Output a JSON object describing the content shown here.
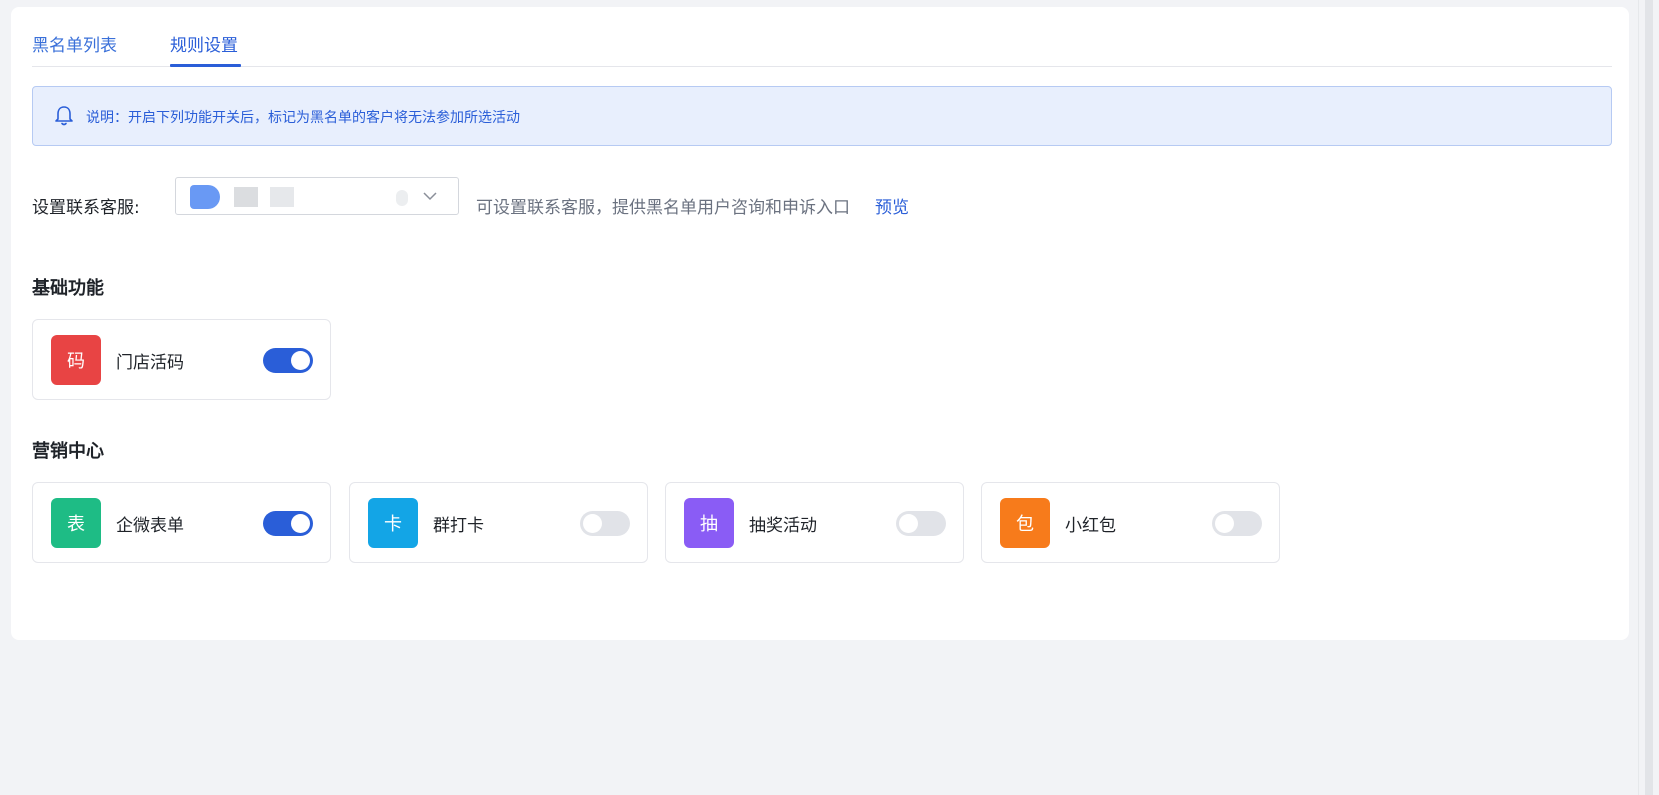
{
  "tabs": [
    {
      "label": "黑名单列表",
      "active": false
    },
    {
      "label": "规则设置",
      "active": true
    }
  ],
  "notice": {
    "icon": "bell-icon",
    "text": "说明：开启下列功能开关后，标记为黑名单的客户将无法参加所选活动"
  },
  "contact": {
    "label": "设置联系客服:",
    "selected_value": "",
    "hint": "可设置联系客服，提供黑名单用户咨询和申诉入口",
    "preview_label": "预览"
  },
  "sections": {
    "basic": {
      "title": "基础功能",
      "items": [
        {
          "icon_char": "码",
          "name": "门店活码",
          "color": "#e84444",
          "enabled": true
        }
      ]
    },
    "marketing": {
      "title": "营销中心",
      "items": [
        {
          "icon_char": "表",
          "name": "企微表单",
          "color": "#1ebc85",
          "enabled": true
        },
        {
          "icon_char": "卡",
          "name": "群打卡",
          "color": "#13a5e6",
          "enabled": false
        },
        {
          "icon_char": "抽",
          "name": "抽奖活动",
          "color": "#8a5cf5",
          "enabled": false
        },
        {
          "icon_char": "包",
          "name": "小红包",
          "color": "#f77b1b",
          "enabled": false
        }
      ]
    }
  },
  "colors": {
    "accent": "#2a5ed8",
    "notice_bg": "#e8effd",
    "toggle_off": "#e1e3e8"
  }
}
